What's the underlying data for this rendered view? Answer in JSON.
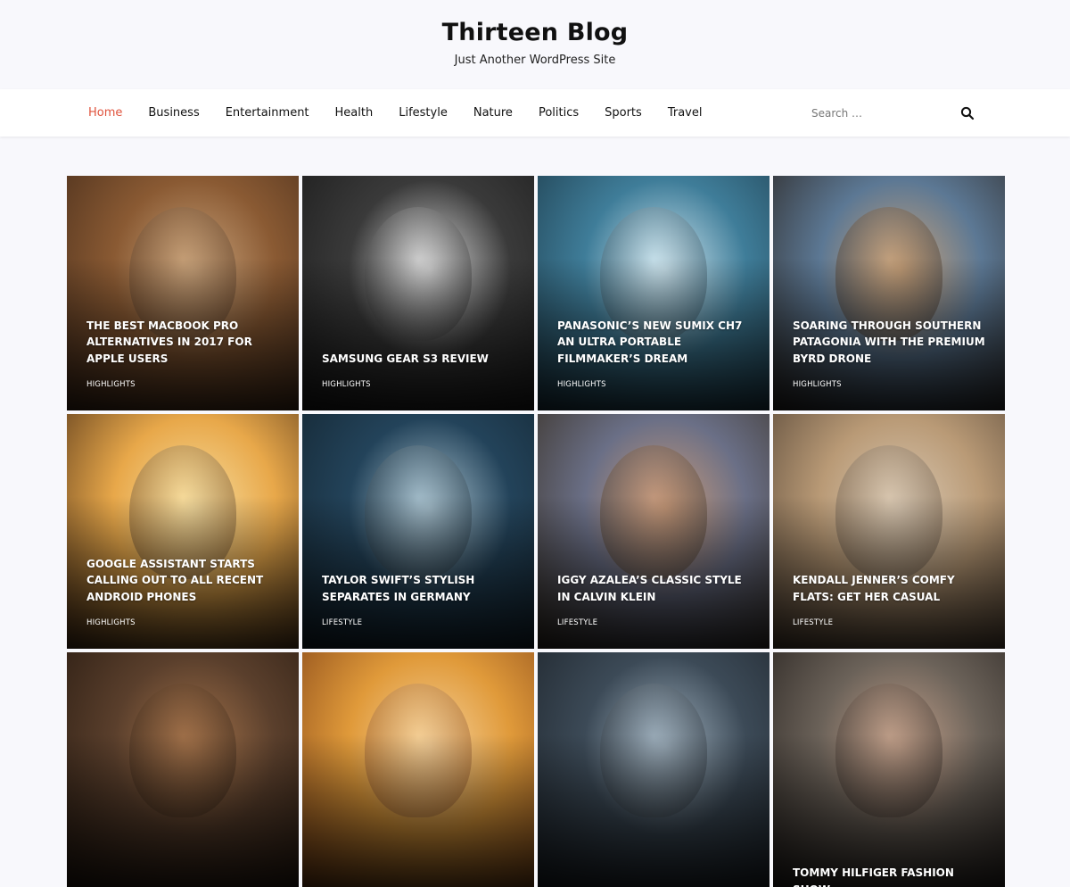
{
  "site": {
    "title": "Thirteen Blog",
    "tagline": "Just Another WordPress Site"
  },
  "nav": {
    "items": [
      {
        "label": "Home",
        "active": true
      },
      {
        "label": "Business"
      },
      {
        "label": "Entertainment"
      },
      {
        "label": "Health"
      },
      {
        "label": "Lifestyle"
      },
      {
        "label": "Nature"
      },
      {
        "label": "Politics"
      },
      {
        "label": "Sports"
      },
      {
        "label": "Travel"
      }
    ],
    "accent_color": "#e0533d"
  },
  "search": {
    "placeholder": "Search …",
    "icon": "search-icon"
  },
  "posts": [
    {
      "title": "The Best MacBook Pro Alternatives in 2017 for Apple Users",
      "category": "Highlights",
      "colors": [
        "#8a5a33",
        "#c8a27a",
        "#4a2f1c"
      ]
    },
    {
      "title": "Samsung Gear S3 Review",
      "category": "Highlights",
      "colors": [
        "#3a3a3a",
        "#d8d8d8",
        "#1c1c1c"
      ]
    },
    {
      "title": "Panasonic’s New Sumix CH7 an Ultra Portable Filmmaker’s Dream",
      "category": "Highlights",
      "colors": [
        "#3f7d99",
        "#cfe6ef",
        "#1f3f4f"
      ]
    },
    {
      "title": "Soaring Through Southern Patagonia with the Premium Byrd Drone",
      "category": "Highlights",
      "colors": [
        "#5c7894",
        "#c9a27a",
        "#2e2a28"
      ]
    },
    {
      "title": "Google Assistant Starts Calling Out to All Recent Android Phones",
      "category": "Highlights",
      "colors": [
        "#e8a84a",
        "#f7dea0",
        "#5a3a1c"
      ]
    },
    {
      "title": "Taylor Swift’s Stylish Separates in Germany",
      "category": "Lifestyle",
      "colors": [
        "#23435a",
        "#a9c2cf",
        "#142632"
      ]
    },
    {
      "title": "Iggy Azalea’s Classic Style in Calvin Klein",
      "category": "Lifestyle",
      "colors": [
        "#6a6f86",
        "#c89a7a",
        "#3b3329"
      ]
    },
    {
      "title": "Kendall Jenner’s Comfy Flats: Get Her Casual",
      "category": "Lifestyle",
      "colors": [
        "#b99a76",
        "#d9c8b2",
        "#5b4a3a"
      ]
    },
    {
      "title": "",
      "category": "",
      "colors": [
        "#5a3f2c",
        "#a3724a",
        "#2a1c12"
      ]
    },
    {
      "title": "",
      "category": "",
      "colors": [
        "#e09a3a",
        "#f5d19a",
        "#8a4a1a"
      ]
    },
    {
      "title": "",
      "category": "",
      "colors": [
        "#3c4a57",
        "#9fb0bd",
        "#1f262d"
      ]
    },
    {
      "title": "Tommy Hilfiger Fashion Show",
      "category": "",
      "colors": [
        "#6b6259",
        "#c2a08a",
        "#2a2522"
      ]
    }
  ]
}
